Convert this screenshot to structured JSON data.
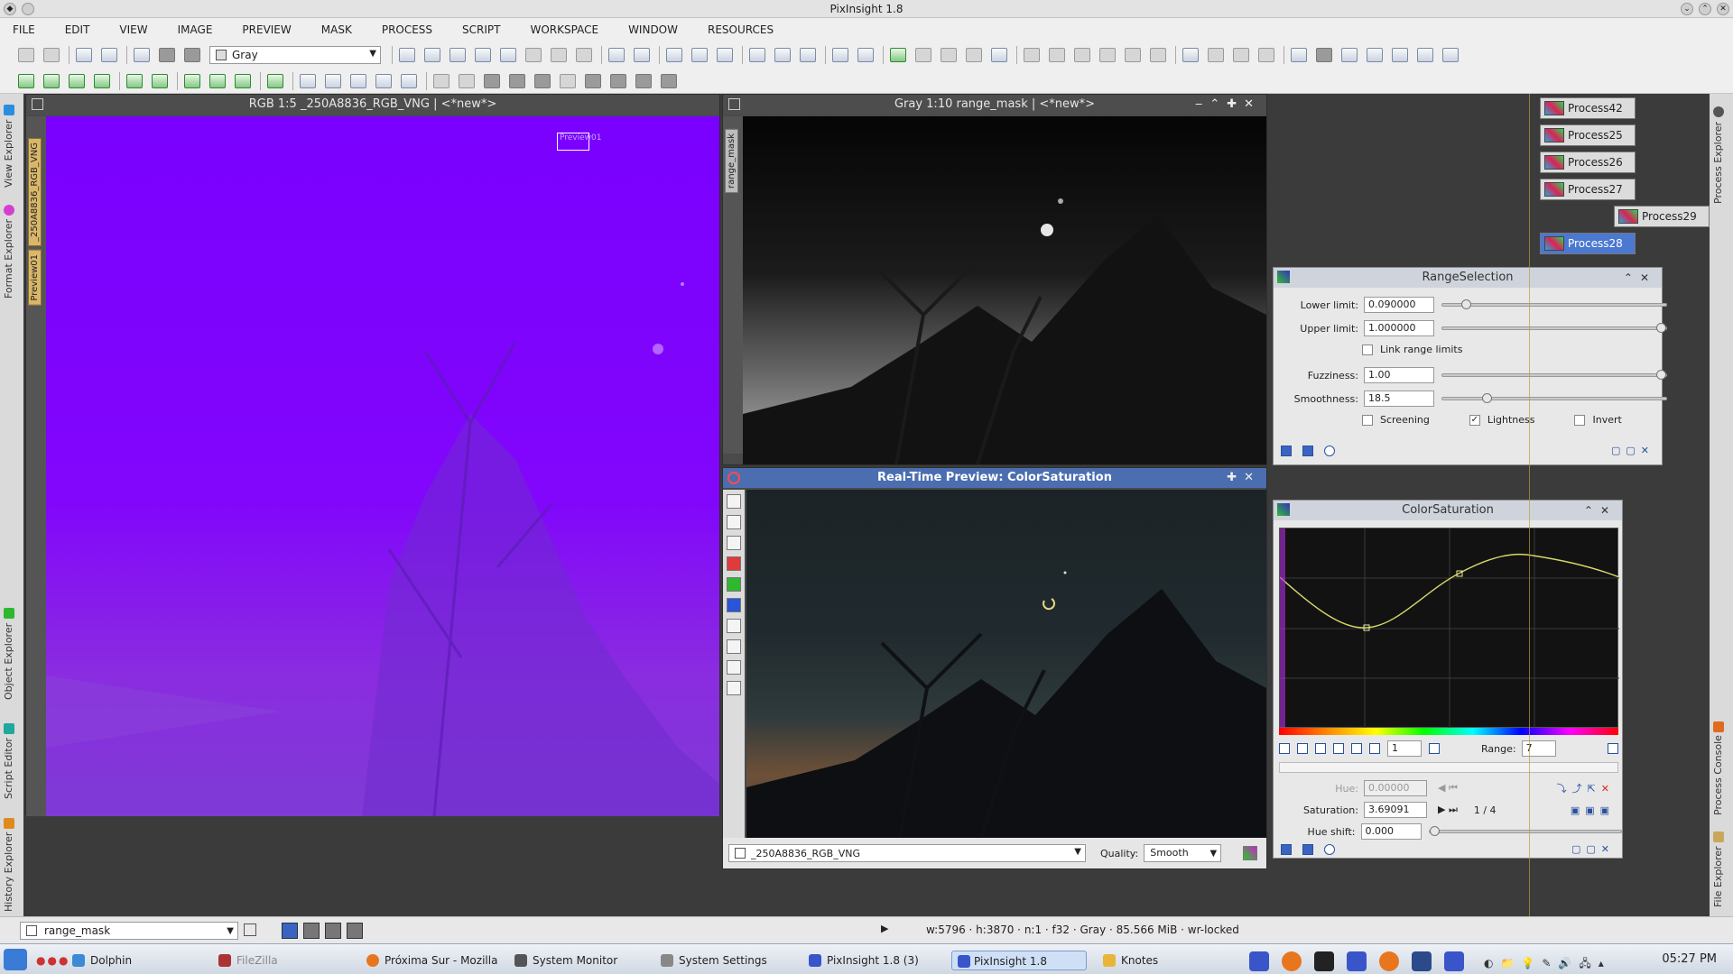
{
  "app": {
    "window_title": "PixInsight 1.8"
  },
  "menu": [
    "FILE",
    "EDIT",
    "VIEW",
    "IMAGE",
    "PREVIEW",
    "MASK",
    "PROCESS",
    "SCRIPT",
    "WORKSPACE",
    "WINDOW",
    "RESOURCES"
  ],
  "toolbar": {
    "mask_mode": "Gray"
  },
  "left_tabs": [
    "View Explorer",
    "Format Explorer",
    "Object Explorer",
    "Script Editor",
    "History Explorer"
  ],
  "right_tabs": [
    "Process Explorer",
    "Process Console",
    "File Explorer"
  ],
  "windows": {
    "rgb": {
      "title": "RGB 1:5 _250A8836_RGB_VNG | <*new*>",
      "preview_label": "Preview01",
      "side_tabs": [
        "_250A8836_RGB_VNG",
        "Preview01"
      ]
    },
    "gray": {
      "title": "Gray 1:10 range_mask | <*new*>",
      "side_tab": "range_mask"
    },
    "realtime": {
      "title": "Real-Time Preview: ColorSaturation",
      "view": "_250A8836_RGB_VNG",
      "quality_label": "Quality:",
      "quality": "Smooth"
    }
  },
  "process_icons": [
    {
      "label": "Process42",
      "selected": false
    },
    {
      "label": "Process25",
      "selected": false
    },
    {
      "label": "Process26",
      "selected": false
    },
    {
      "label": "Process27",
      "selected": false
    },
    {
      "label": "Process29",
      "selected": false
    },
    {
      "label": "Process28",
      "selected": true
    }
  ],
  "range_selection": {
    "title": "RangeSelection",
    "lower_limit_label": "Lower limit:",
    "lower_limit": "0.090000",
    "lower_limit_pos": 0.09,
    "upper_limit_label": "Upper limit:",
    "upper_limit": "1.000000",
    "upper_limit_pos": 1.0,
    "link_label": "Link range limits",
    "fuzziness_label": "Fuzziness:",
    "fuzziness": "1.00",
    "fuzziness_pos": 1.0,
    "smoothness_label": "Smoothness:",
    "smoothness": "18.5",
    "smoothness_pos": 0.185,
    "screening_label": "Screening",
    "lightness_label": "Lightness",
    "invert_label": "Invert",
    "screening": false,
    "lightness": true,
    "invert": false
  },
  "color_saturation": {
    "title": "ColorSaturation",
    "range_label": "Range:",
    "range": "7",
    "stepper": "1",
    "hue_label": "Hue:",
    "hue": "0.00000",
    "saturation_label": "Saturation:",
    "saturation": "3.69091",
    "point_index": "1 / 4",
    "hue_shift_label": "Hue shift:",
    "hue_shift": "0.000"
  },
  "status": {
    "view": "range_mask",
    "text": "w:5796 · h:3870 · n:1 · f32 · Gray · 85.566 MiB · wr-locked"
  },
  "taskbar": {
    "items": [
      "Dolphin",
      "FileZilla",
      "Próxima Sur - Mozilla",
      "System Monitor",
      "System Settings",
      "PixInsight 1.8 (3)",
      "PixInsight 1.8",
      "Knotes"
    ],
    "active": "PixInsight 1.8",
    "clock": "05:27 PM"
  }
}
